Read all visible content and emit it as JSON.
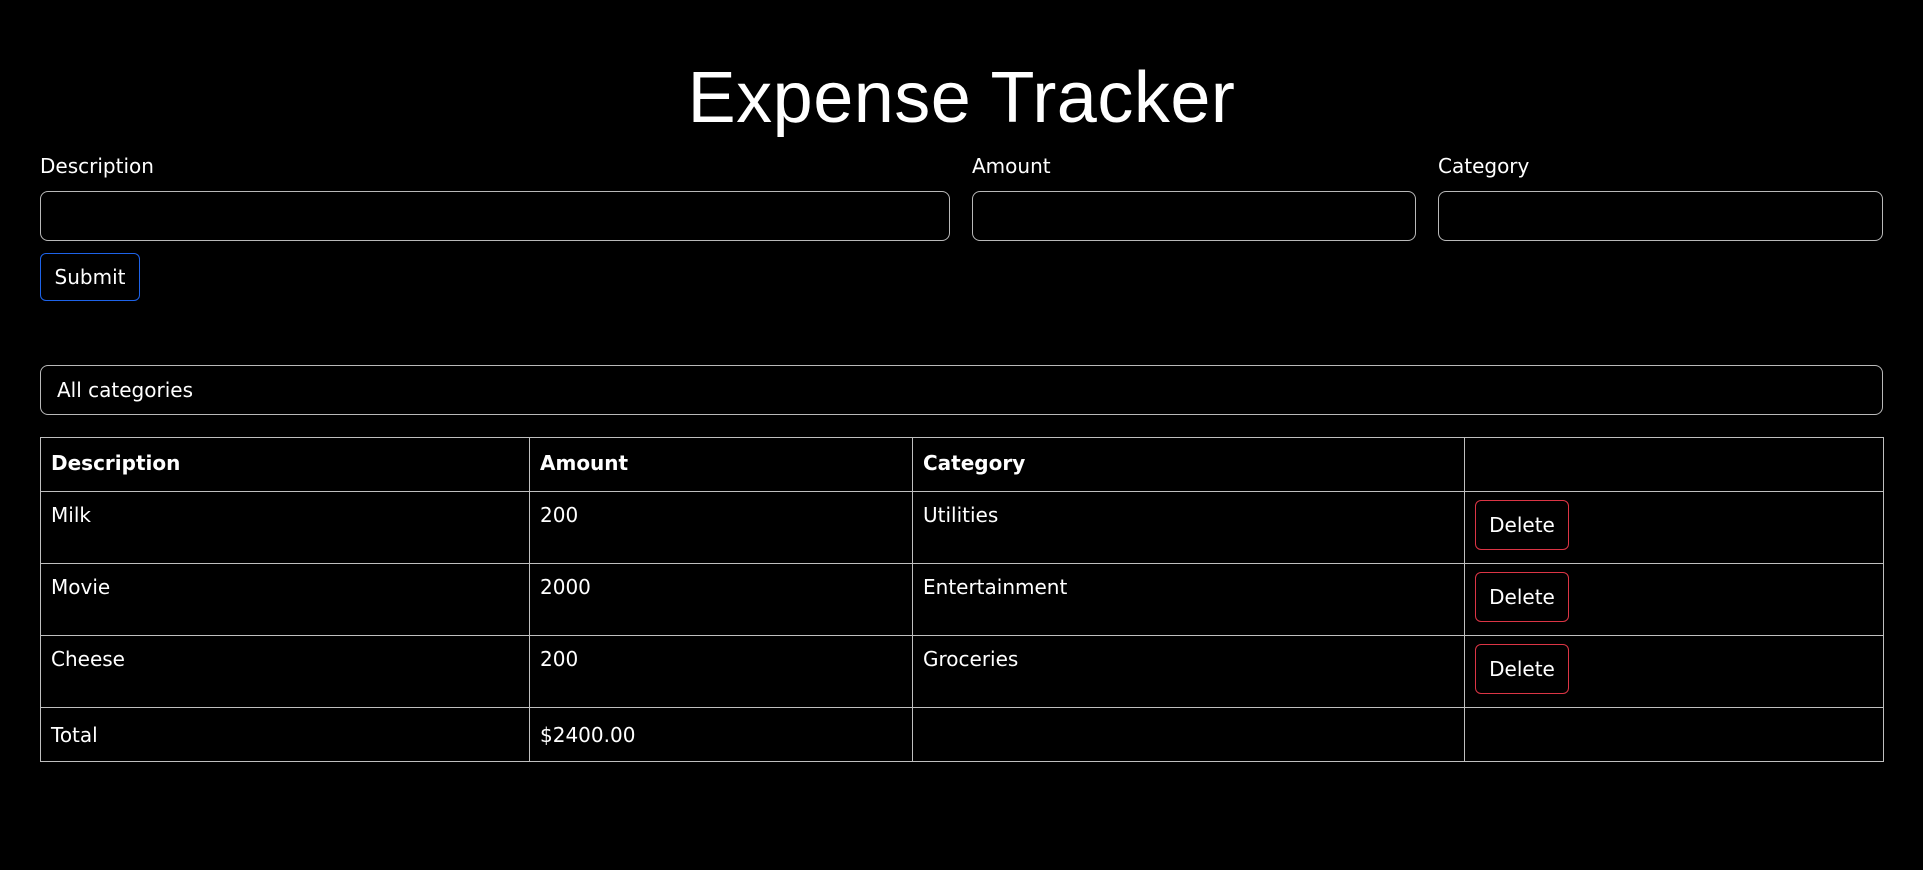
{
  "header": {
    "title": "Expense Tracker"
  },
  "form": {
    "description_label": "Description",
    "description_value": "",
    "amount_label": "Amount",
    "amount_value": "",
    "category_label": "Category",
    "category_value": "",
    "submit_label": "Submit"
  },
  "filter": {
    "selected": "All categories"
  },
  "table": {
    "columns": [
      "Description",
      "Amount",
      "Category",
      ""
    ],
    "rows": [
      {
        "description": "Milk",
        "amount": "200",
        "category": "Utilities",
        "action": "Delete"
      },
      {
        "description": "Movie",
        "amount": "2000",
        "category": "Entertainment",
        "action": "Delete"
      },
      {
        "description": "Cheese",
        "amount": "200",
        "category": "Groceries",
        "action": "Delete"
      }
    ],
    "total_label": "Total",
    "total_value": "$2400.00"
  },
  "colors": {
    "background": "#000000",
    "text": "#ffffff",
    "primary_outline": "#1e63e9",
    "danger_outline": "#dc3545",
    "border": "#bfbfbf"
  }
}
